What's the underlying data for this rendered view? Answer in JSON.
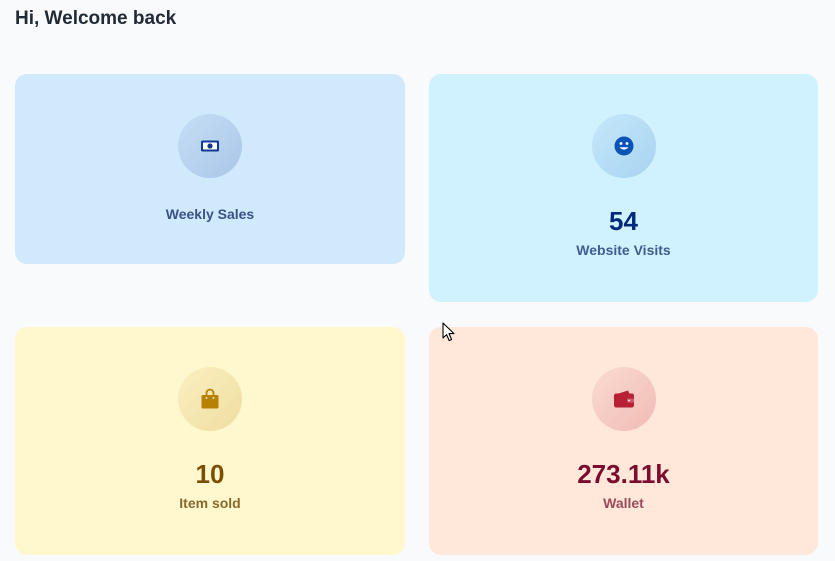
{
  "header": {
    "greeting": "Hi, Welcome back"
  },
  "cards": {
    "sales": {
      "value": "",
      "label": "Weekly Sales",
      "icon": "money-bill-icon",
      "accent": "#103996"
    },
    "visits": {
      "value": "54",
      "label": "Website Visits",
      "icon": "smiley-face-icon",
      "accent": "#0c53b7"
    },
    "items": {
      "value": "10",
      "label": "Item sold",
      "icon": "shopping-bag-icon",
      "accent": "#b78103"
    },
    "wallet": {
      "value": "273.11k",
      "label": "Wallet",
      "icon": "wallet-icon",
      "accent": "#b72136"
    }
  }
}
